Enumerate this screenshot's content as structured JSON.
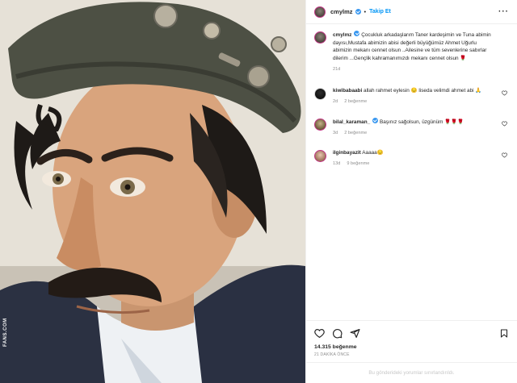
{
  "post": {
    "username": "cmylmz",
    "follow_label": "Takip Et",
    "more_icon": "more-horizontal-icon",
    "caption_text": "Çocukluk arkadaşlarım Taner kardeşimin ve Tuna abimin dayısı,Mustafa abimizin abisi değerli büyüğümüz Ahmet Uğurlu abimizin mekanı cennet olsun ..Ailesine ve tüm sevenlerine sabırlar dilerim ...Gençlik kahramanımızdı mekanı cennet olsun 🌹",
    "caption_time": "21d",
    "likes": "14.315 beğenme",
    "time_ago": "21 DAKİKA ÖNCE",
    "comments_restricted": "Bu gönderideki yorumlar sınırlandırıldı."
  },
  "comments": [
    {
      "username": "kiwibabaabi",
      "text": "allah rahmet eylesin 😔 liseda velimdi ahmet abi 🙏",
      "time": "2d",
      "likes": "2 beğenme"
    },
    {
      "username": "bilal_karaman_",
      "text": "Başınız sağolsun, üzgünüm 🌹🌹🌹",
      "time": "3d",
      "likes": "2 beğenme"
    },
    {
      "username": "ilginbayazit",
      "text": "Aaaaa😔",
      "time": "13d",
      "likes": "9 beğenme"
    }
  ],
  "icons": {
    "like": "heart-icon",
    "comment": "comment-icon",
    "share": "paper-plane-icon",
    "save": "bookmark-icon"
  },
  "photo": {
    "watermark": "FANS.COM"
  }
}
